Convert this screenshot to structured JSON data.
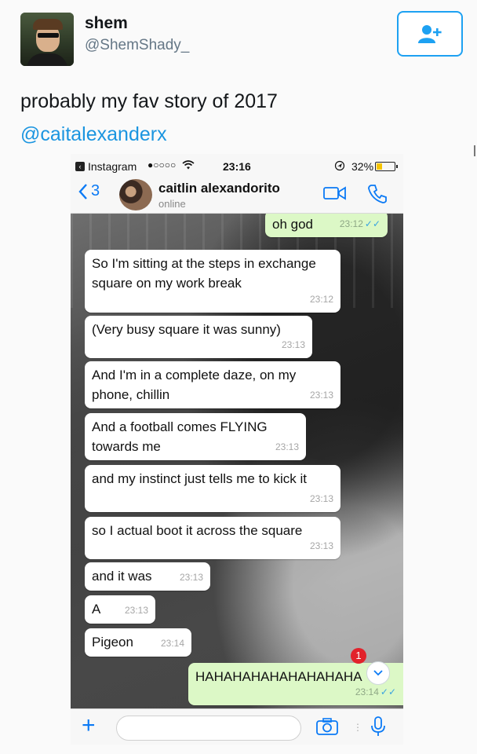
{
  "tweet": {
    "user_name": "shem",
    "user_handle": "@ShemShady_",
    "text": "probably my fav story of 2017",
    "mention": "@caitalexanderx"
  },
  "status_bar": {
    "back_app": "Instagram",
    "signal": "●○○○○",
    "time": "23:16",
    "battery": "32%"
  },
  "chat_header": {
    "back_count": "3",
    "contact_name": "caitlin alexandorito",
    "contact_status": "online"
  },
  "messages": [
    {
      "dir": "out",
      "text": "oh god",
      "time": "23:12",
      "read": "✓✓"
    },
    {
      "dir": "in",
      "text": "So I'm sitting at the steps in exchange square on my work break",
      "time": "23:12"
    },
    {
      "dir": "in",
      "text": "(Very busy square it was sunny)",
      "time": "23:13"
    },
    {
      "dir": "in",
      "text": "And I'm in a complete daze, on my phone, chillin",
      "time": "23:13"
    },
    {
      "dir": "in",
      "text": "And a football comes FLYING towards me",
      "time": "23:13"
    },
    {
      "dir": "in",
      "text": "and my instinct just tells me to kick it",
      "time": "23:13"
    },
    {
      "dir": "in",
      "text": "so I actual boot it across the square",
      "time": "23:13"
    },
    {
      "dir": "in",
      "text": "and it was",
      "time": "23:13"
    },
    {
      "dir": "in",
      "text": "A",
      "time": "23:13"
    },
    {
      "dir": "in",
      "text": "Pigeon",
      "time": "23:14"
    },
    {
      "dir": "out",
      "text": "HAHAHAHAHAHAHAHAHA",
      "time": "23:14",
      "read": "✓✓"
    }
  ],
  "unread_badge": "1",
  "colors": {
    "twitter_blue": "#1da1f2",
    "ios_blue": "#0b7af5",
    "outgoing_bubble": "#dcf8c6",
    "badge_red": "#e2222b"
  },
  "icons": [
    "add-user-icon",
    "back-chevron-icon",
    "video-call-icon",
    "phone-call-icon",
    "plus-icon",
    "camera-icon",
    "microphone-icon",
    "chevron-down-icon",
    "wifi-icon",
    "location-icon"
  ]
}
